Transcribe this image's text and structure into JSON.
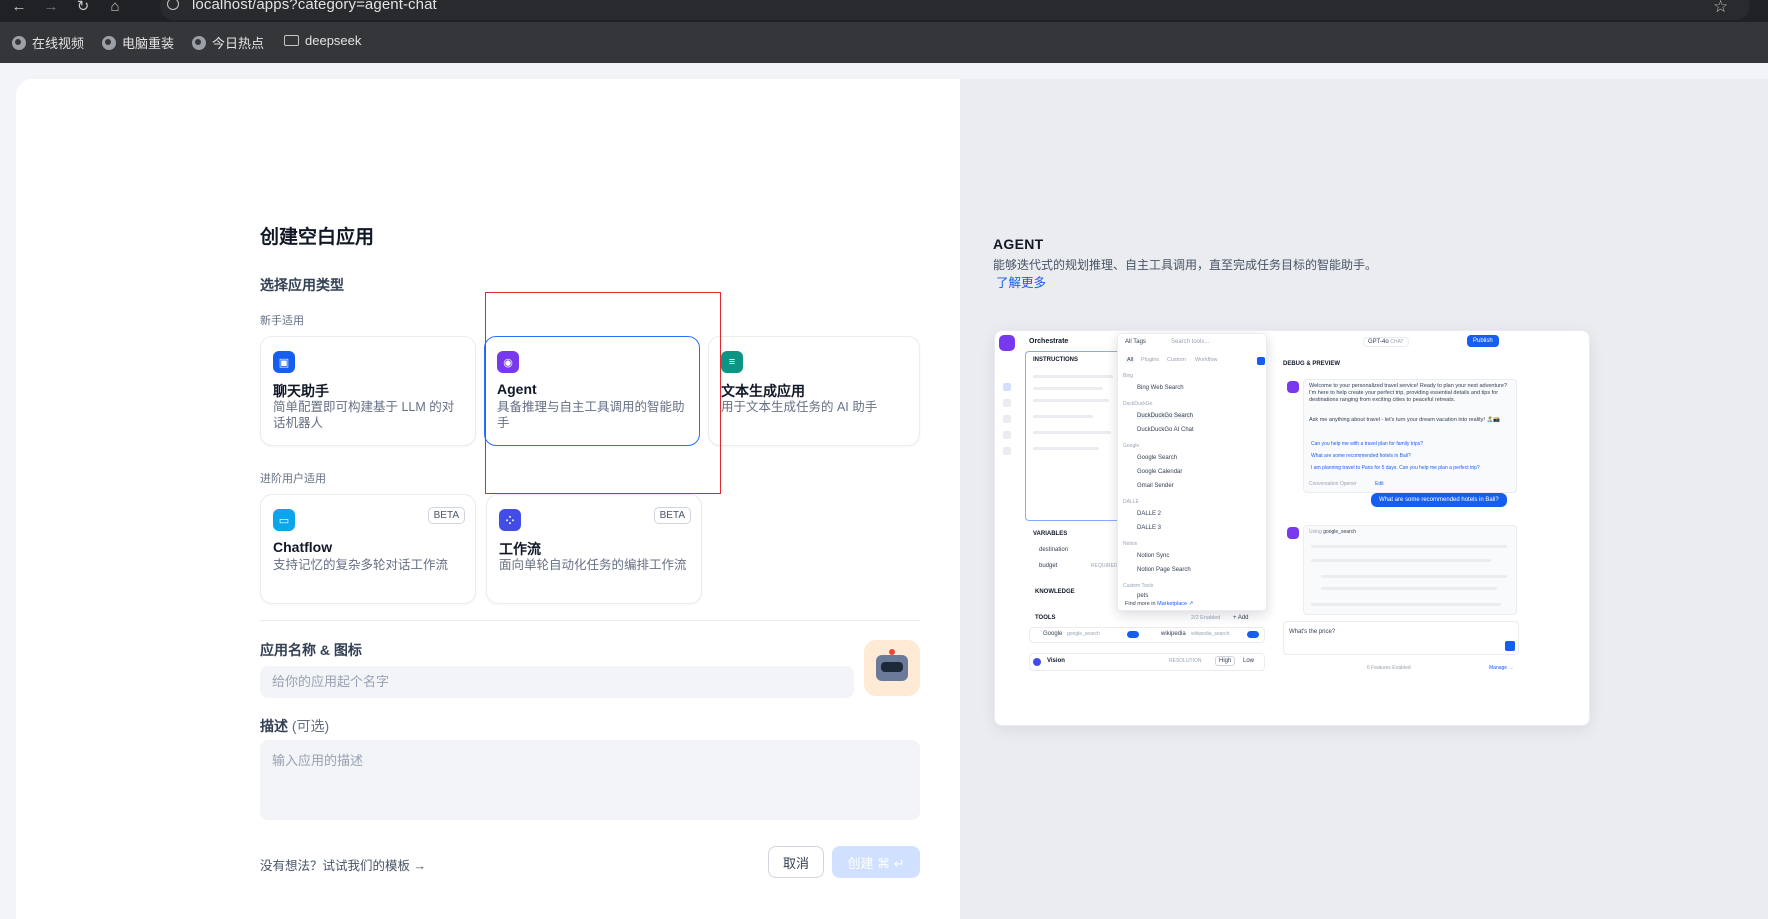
{
  "browser": {
    "url": "localhost/apps?category=agent-chat",
    "bookmarks": [
      "在线视频",
      "电脑重装",
      "今日热点",
      "deepseek"
    ]
  },
  "form": {
    "title": "创建空白应用",
    "type_section": "选择应用类型",
    "beginner_label": "新手适用",
    "advanced_label": "进阶用户适用",
    "cards": [
      {
        "title": "聊天助手",
        "desc": "简单配置即可构建基于 LLM 的对话机器人",
        "color": "#155eef"
      },
      {
        "title": "Agent",
        "desc": "具备推理与自主工具调用的智能助手",
        "color": "#7839ee"
      },
      {
        "title": "文本生成应用",
        "desc": "用于文本生成任务的 AI 助手",
        "color": "#0e9384"
      },
      {
        "title": "Chatflow",
        "desc": "支持记忆的复杂多轮对话工作流",
        "badge": "BETA",
        "color": "#0ba5ec"
      },
      {
        "title": "工作流",
        "desc": "面向单轮自动化任务的编排工作流",
        "badge": "BETA",
        "color": "#444ce7"
      }
    ],
    "name_section": "应用名称 & 图标",
    "name_placeholder": "给你的应用起个名字",
    "desc_section": "描述",
    "desc_optional": "(可选)",
    "desc_placeholder": "输入应用的描述",
    "template_link": "没有想法？试试我们的模板 →",
    "cancel_label": "取消",
    "create_label": "创建 ⌘ ↵"
  },
  "preview_panel": {
    "title": "AGENT",
    "description": "能够迭代式的规划推理、自主工具调用，直至完成任务目标的智能助手。",
    "learn_more": "了解更多",
    "mock": {
      "orchestrate": "Orchestrate",
      "instructions": "INSTRUCTIONS",
      "all_tags": "All Tags",
      "search_tools": "Search tools...",
      "filter_tabs": [
        "All",
        "Plugins",
        "Custom",
        "Workflow"
      ],
      "tool_groups": [
        {
          "group": "Bing",
          "items": [
            "Bing Web Search"
          ]
        },
        {
          "group": "DuckDuckGo",
          "items": [
            "DuckDuckGo Search",
            "DuckDuckGo AI Chat"
          ]
        },
        {
          "group": "Google",
          "items": [
            "Google Search",
            "Google Calendar",
            "Gmail Sender"
          ]
        },
        {
          "group": "DALLE",
          "items": [
            "DALLE 2",
            "DALLE 3"
          ]
        },
        {
          "group": "Notion",
          "items": [
            "Notion Sync",
            "Notion Page Search"
          ]
        },
        {
          "group": "Custom Tools",
          "items": [
            "pets"
          ]
        }
      ],
      "find_more": "Find more in",
      "marketplace": "Marketplace ↗",
      "variables": "VARIABLES",
      "var_items": [
        "destination",
        "budget"
      ],
      "required": "REQUIRED",
      "knowledge": "KNOWLEDGE",
      "tools": "TOOLS",
      "tools_enabled": "2/2 Enabled",
      "add": "+ Add",
      "tool_google": "Google",
      "tool_google_id": "google_search",
      "tool_wiki": "wikipedia",
      "tool_wiki_id": "wikipedia_search",
      "vision": "Vision",
      "resolution": "RESOLUTION",
      "high": "High",
      "low": "Low",
      "model": "GPT-4o",
      "chat_tag": "CHAT",
      "publish": "Publish",
      "debug_title": "DEBUG & PREVIEW",
      "welcome": "Welcome to your personalized travel service! Ready to plan your next adventure? I'm here to help create your perfect trip, providing essential details and tips for destinations ranging from exciting cities to peaceful retreats.",
      "ask": "Ask me anything about travel - let's turn your dream vacation into reality! 🏝️📸",
      "suggestions": [
        "Can you help me with a travel plan for family trips?",
        "What are some recommended hotels in Bali?",
        "I am planning travel to Paris for 5 days. Can you help me plan a perfect trip?"
      ],
      "opener": "Conversation Opener",
      "edit": "Edit",
      "user_msg": "What are some recommended hotels in Bali?",
      "using": "Using",
      "using_tool": "google_search",
      "input_text": "What's the price?",
      "features": "6 Features Enabled",
      "manage": "Manage →"
    }
  }
}
